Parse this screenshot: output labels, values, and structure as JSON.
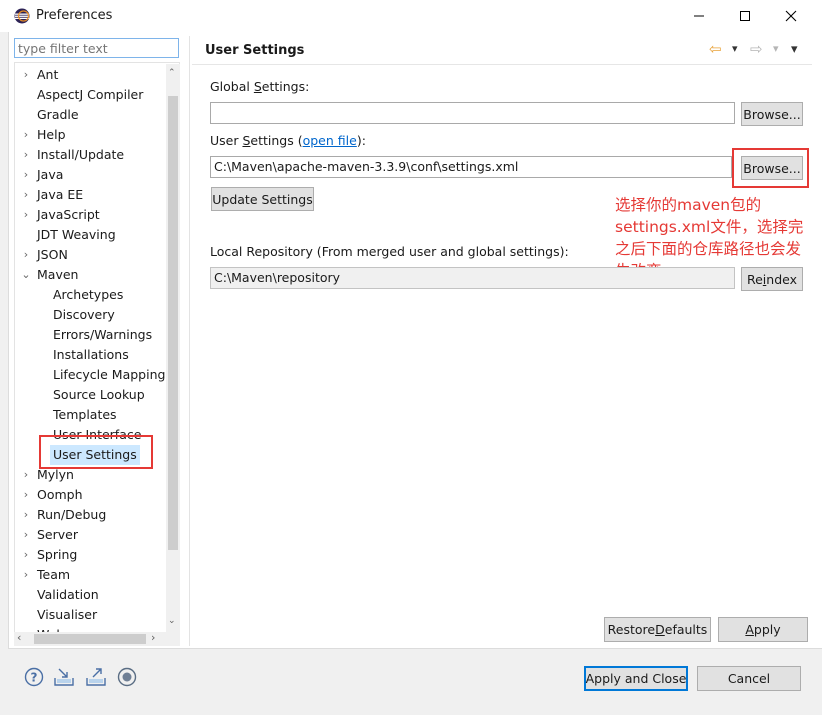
{
  "window": {
    "title": "Preferences",
    "minimize_glyph": "—",
    "maximize_glyph": "☐",
    "close_glyph": "✕"
  },
  "left_pane": {
    "filter_placeholder": "type filter text",
    "tree": [
      {
        "label": "Ant",
        "expander": "›"
      },
      {
        "label": "AspectJ Compiler",
        "expander": ""
      },
      {
        "label": "Gradle",
        "expander": ""
      },
      {
        "label": "Help",
        "expander": "›"
      },
      {
        "label": "Install/Update",
        "expander": "›"
      },
      {
        "label": "Java",
        "expander": "›"
      },
      {
        "label": "Java EE",
        "expander": "›"
      },
      {
        "label": "JavaScript",
        "expander": "›"
      },
      {
        "label": "JDT Weaving",
        "expander": ""
      },
      {
        "label": "JSON",
        "expander": "›"
      },
      {
        "label": "Maven",
        "expander": "⌄"
      },
      {
        "label": "Archetypes",
        "child": true
      },
      {
        "label": "Discovery",
        "child": true
      },
      {
        "label": "Errors/Warnings",
        "child": true
      },
      {
        "label": "Installations",
        "child": true
      },
      {
        "label": "Lifecycle Mappings",
        "child": true
      },
      {
        "label": "Source Lookup",
        "child": true
      },
      {
        "label": "Templates",
        "child": true
      },
      {
        "label": "User Interface",
        "child": true
      },
      {
        "label": "User Settings",
        "child": true,
        "selected": true
      },
      {
        "label": "Mylyn",
        "expander": "›"
      },
      {
        "label": "Oomph",
        "expander": "›"
      },
      {
        "label": "Run/Debug",
        "expander": "›"
      },
      {
        "label": "Server",
        "expander": "›"
      },
      {
        "label": "Spring",
        "expander": "›"
      },
      {
        "label": "Team",
        "expander": "›"
      },
      {
        "label": "Validation",
        "expander": ""
      },
      {
        "label": "Visualiser",
        "expander": ""
      },
      {
        "label": "Web",
        "expander": "›"
      }
    ]
  },
  "page": {
    "title": "User Settings",
    "nav": {
      "back": "⇦",
      "forward": "⇨",
      "dropdown": "▾",
      "menu": "▾"
    },
    "global_settings": {
      "label_pre": "Global ",
      "label_mnemonic": "S",
      "label_post": "ettings:",
      "value": "",
      "browse": "Browse..."
    },
    "user_settings": {
      "label_pre": "User ",
      "label_mnemonic": "S",
      "label_post": "ettings (",
      "link": "open file",
      "label_end": "):",
      "value": "C:\\Maven\\apache-maven-3.3.9\\conf\\settings.xml",
      "browse": "Browse..."
    },
    "update_button": "Update Settings",
    "local_repo": {
      "label": "Local Repository (From merged user and global settings):",
      "value": "C:\\Maven\\repository",
      "reindex_pre": "Re",
      "reindex_mnemonic": "i",
      "reindex_post": "ndex"
    },
    "annotation_lines": [
      "选择你的maven包的",
      "settings.xml文件，选择完",
      "之后下面的仓库路径也会发",
      "生改变"
    ],
    "restore_defaults": {
      "pre": "Restore ",
      "mnemonic": "D",
      "post": "efaults"
    },
    "apply": {
      "mnemonic": "A",
      "post": "pply"
    }
  },
  "footer": {
    "apply_and_close": "Apply and Close",
    "cancel": "Cancel",
    "icons": [
      "help-icon",
      "import-icon",
      "export-icon",
      "oomph-record-icon"
    ]
  },
  "colors": {
    "annotation_red": "#e53935",
    "selection": "#cce8ff",
    "link": "#0066cc"
  }
}
